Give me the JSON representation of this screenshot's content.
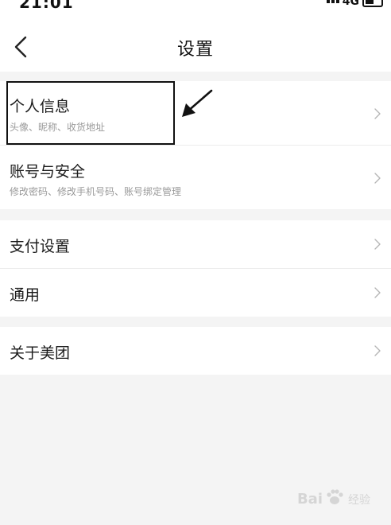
{
  "status_bar": {
    "time": "21:01",
    "network": "4G"
  },
  "header": {
    "title": "设置"
  },
  "groups": [
    {
      "items": [
        {
          "title": "个人信息",
          "subtitle": "头像、昵称、收货地址"
        },
        {
          "title": "账号与安全",
          "subtitle": "修改密码、修改手机号码、账号绑定管理"
        }
      ]
    },
    {
      "items": [
        {
          "title": "支付设置"
        },
        {
          "title": "通用"
        }
      ]
    },
    {
      "items": [
        {
          "title": "关于美团"
        }
      ]
    }
  ],
  "watermark": {
    "brand_left": "Bai",
    "brand_right": "经验"
  },
  "icons": {
    "back": "chevron-left-icon",
    "row_arrow": "chevron-right-icon"
  },
  "colors": {
    "background": "#f4f4f4",
    "card": "#ffffff",
    "subtitle": "#9a9a9a"
  }
}
